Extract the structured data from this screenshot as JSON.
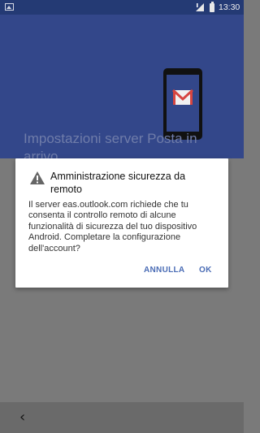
{
  "status_bar": {
    "time": "13:30",
    "icons": [
      "image-icon",
      "signal-icon",
      "battery-icon"
    ]
  },
  "header": {
    "title_line1": "Impostazioni server Posta in",
    "title_line2": "arrivo",
    "illustration": "gmail-phone-icon"
  },
  "dialog": {
    "icon": "warning-icon",
    "title": "Amministrazione sicurezza da remoto",
    "message": "Il server eas.outlook.com richiede che tu consenta il controllo remoto di alcune funzionalità di sicurezza del tuo dispositivo Android. Completare la configurazione dell'account?",
    "cancel_label": "ANNULLA",
    "ok_label": "OK"
  },
  "nav_bar": {
    "back_icon": "back-chevron-icon"
  },
  "colors": {
    "header": "#33478a",
    "status_bar": "#243a74",
    "accent": "#4a6cb5",
    "scrim": "#7a7a7a"
  }
}
